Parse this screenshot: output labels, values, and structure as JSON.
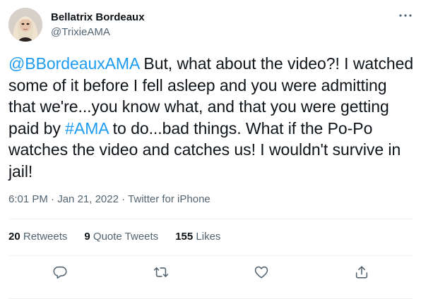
{
  "author": {
    "name": "Bellatrix Bordeaux",
    "handle": "@TrixieAMA"
  },
  "tweet": {
    "mention": "@BBordeauxAMA",
    "text_part1": " But, what about the video?! I watched some of it before I fell asleep and you were admitting that we're...you know what, and that you were getting paid by ",
    "hashtag": "#AMA",
    "text_part2": " to do...bad things. What if the Po-Po watches the video and catches us! I wouldn't survive in jail!"
  },
  "meta": {
    "time": "6:01 PM",
    "separator": " · ",
    "date": "Jan 21, 2022",
    "source": "Twitter for iPhone"
  },
  "stats": {
    "retweets_count": "20",
    "retweets_label": "Retweets",
    "quotes_count": "9",
    "quotes_label": "Quote Tweets",
    "likes_count": "155",
    "likes_label": "Likes"
  },
  "icons": {
    "more": "more-horizontal-icon",
    "reply": "reply-icon",
    "retweet": "retweet-icon",
    "like": "heart-icon",
    "share": "share-icon"
  },
  "colors": {
    "link": "#1d9bf0",
    "text": "#0f1419",
    "secondary": "#536471",
    "divider": "#eff3f4"
  }
}
